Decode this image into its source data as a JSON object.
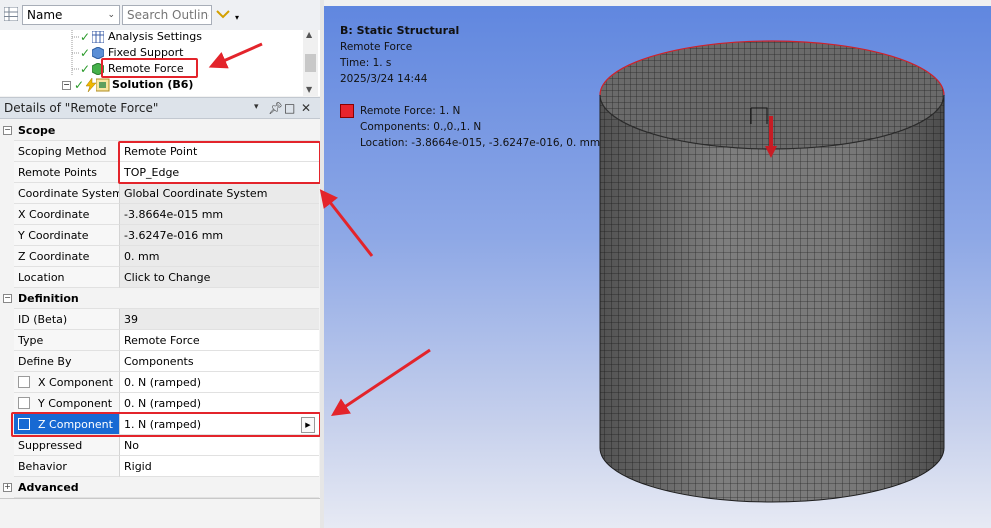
{
  "toolbar": {
    "sort_select": "Name",
    "search_placeholder": "Search Outline"
  },
  "tree": {
    "items": [
      {
        "label": "Analysis Settings",
        "icon": "analysis-settings-icon"
      },
      {
        "label": "Fixed Support",
        "icon": "fixed-support-icon"
      },
      {
        "label": "Remote Force",
        "icon": "remote-force-icon"
      },
      {
        "label": "Solution (B6)",
        "icon": "solution-icon"
      }
    ]
  },
  "details": {
    "title": "Details of \"Remote Force\"",
    "header_buttons": [
      "▾",
      "⊥",
      "□",
      "✕"
    ],
    "sections": [
      {
        "name": "Scope",
        "expanded": true,
        "rows": [
          {
            "label": "Scoping Method",
            "value": "Remote Point"
          },
          {
            "label": "Remote Points",
            "value": "TOP_Edge"
          },
          {
            "label": "Coordinate System",
            "value": "Global Coordinate System"
          },
          {
            "label": "X Coordinate",
            "value": "-3.8664e-015 mm"
          },
          {
            "label": "Y Coordinate",
            "value": "-3.6247e-016 mm"
          },
          {
            "label": "Z Coordinate",
            "value": "0. mm"
          },
          {
            "label": "Location",
            "value": "Click to Change"
          }
        ]
      },
      {
        "name": "Definition",
        "expanded": true,
        "rows": [
          {
            "label": "ID (Beta)",
            "value": "39"
          },
          {
            "label": "Type",
            "value": "Remote Force"
          },
          {
            "label": "Define By",
            "value": "Components"
          },
          {
            "label": "X Component",
            "value": "0. N  (ramped)"
          },
          {
            "label": "Y Component",
            "value": "0. N  (ramped)"
          },
          {
            "label": "Z Component",
            "value": "1. N  (ramped)"
          },
          {
            "label": "Suppressed",
            "value": "No"
          },
          {
            "label": "Behavior",
            "value": "Rigid"
          }
        ]
      },
      {
        "name": "Advanced",
        "expanded": false,
        "rows": []
      }
    ]
  },
  "viewport": {
    "title": "B: Static Structural",
    "subtitle": "Remote Force",
    "time": "Time: 1. s",
    "date": "2025/3/24 14:44",
    "legend": {
      "label": "Remote Force: 1. N",
      "components": "Components: 0.,0.,1. N",
      "location": "Location: -3.8664e-015, -3.6247e-016, 0. mm",
      "color": "#e8242c"
    }
  },
  "colors": {
    "selection": "#1769d3",
    "annotation_red": "#e3242b",
    "mesh_face": "#7c7c7c",
    "mesh_line": "#2e2e2e"
  }
}
